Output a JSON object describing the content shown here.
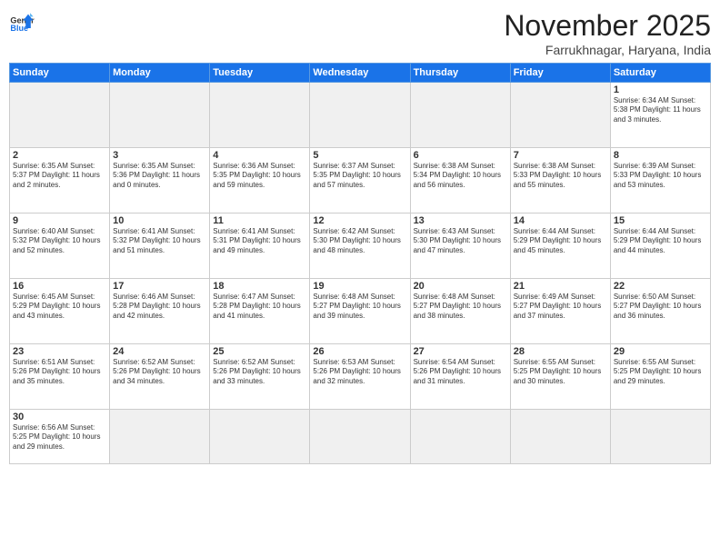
{
  "logo": {
    "text_general": "General",
    "text_blue": "Blue"
  },
  "header": {
    "month": "November 2025",
    "location": "Farrukhnagar, Haryana, India"
  },
  "weekdays": [
    "Sunday",
    "Monday",
    "Tuesday",
    "Wednesday",
    "Thursday",
    "Friday",
    "Saturday"
  ],
  "weeks": [
    [
      {
        "num": "",
        "info": "",
        "empty": true
      },
      {
        "num": "",
        "info": "",
        "empty": true
      },
      {
        "num": "",
        "info": "",
        "empty": true
      },
      {
        "num": "",
        "info": "",
        "empty": true
      },
      {
        "num": "",
        "info": "",
        "empty": true
      },
      {
        "num": "",
        "info": "",
        "empty": true
      },
      {
        "num": "1",
        "info": "Sunrise: 6:34 AM\nSunset: 5:38 PM\nDaylight: 11 hours and 3 minutes."
      }
    ],
    [
      {
        "num": "2",
        "info": "Sunrise: 6:35 AM\nSunset: 5:37 PM\nDaylight: 11 hours and 2 minutes."
      },
      {
        "num": "3",
        "info": "Sunrise: 6:35 AM\nSunset: 5:36 PM\nDaylight: 11 hours and 0 minutes."
      },
      {
        "num": "4",
        "info": "Sunrise: 6:36 AM\nSunset: 5:35 PM\nDaylight: 10 hours and 59 minutes."
      },
      {
        "num": "5",
        "info": "Sunrise: 6:37 AM\nSunset: 5:35 PM\nDaylight: 10 hours and 57 minutes."
      },
      {
        "num": "6",
        "info": "Sunrise: 6:38 AM\nSunset: 5:34 PM\nDaylight: 10 hours and 56 minutes."
      },
      {
        "num": "7",
        "info": "Sunrise: 6:38 AM\nSunset: 5:33 PM\nDaylight: 10 hours and 55 minutes."
      },
      {
        "num": "8",
        "info": "Sunrise: 6:39 AM\nSunset: 5:33 PM\nDaylight: 10 hours and 53 minutes."
      }
    ],
    [
      {
        "num": "9",
        "info": "Sunrise: 6:40 AM\nSunset: 5:32 PM\nDaylight: 10 hours and 52 minutes."
      },
      {
        "num": "10",
        "info": "Sunrise: 6:41 AM\nSunset: 5:32 PM\nDaylight: 10 hours and 51 minutes."
      },
      {
        "num": "11",
        "info": "Sunrise: 6:41 AM\nSunset: 5:31 PM\nDaylight: 10 hours and 49 minutes."
      },
      {
        "num": "12",
        "info": "Sunrise: 6:42 AM\nSunset: 5:30 PM\nDaylight: 10 hours and 48 minutes."
      },
      {
        "num": "13",
        "info": "Sunrise: 6:43 AM\nSunset: 5:30 PM\nDaylight: 10 hours and 47 minutes."
      },
      {
        "num": "14",
        "info": "Sunrise: 6:44 AM\nSunset: 5:29 PM\nDaylight: 10 hours and 45 minutes."
      },
      {
        "num": "15",
        "info": "Sunrise: 6:44 AM\nSunset: 5:29 PM\nDaylight: 10 hours and 44 minutes."
      }
    ],
    [
      {
        "num": "16",
        "info": "Sunrise: 6:45 AM\nSunset: 5:29 PM\nDaylight: 10 hours and 43 minutes."
      },
      {
        "num": "17",
        "info": "Sunrise: 6:46 AM\nSunset: 5:28 PM\nDaylight: 10 hours and 42 minutes."
      },
      {
        "num": "18",
        "info": "Sunrise: 6:47 AM\nSunset: 5:28 PM\nDaylight: 10 hours and 41 minutes."
      },
      {
        "num": "19",
        "info": "Sunrise: 6:48 AM\nSunset: 5:27 PM\nDaylight: 10 hours and 39 minutes."
      },
      {
        "num": "20",
        "info": "Sunrise: 6:48 AM\nSunset: 5:27 PM\nDaylight: 10 hours and 38 minutes."
      },
      {
        "num": "21",
        "info": "Sunrise: 6:49 AM\nSunset: 5:27 PM\nDaylight: 10 hours and 37 minutes."
      },
      {
        "num": "22",
        "info": "Sunrise: 6:50 AM\nSunset: 5:27 PM\nDaylight: 10 hours and 36 minutes."
      }
    ],
    [
      {
        "num": "23",
        "info": "Sunrise: 6:51 AM\nSunset: 5:26 PM\nDaylight: 10 hours and 35 minutes."
      },
      {
        "num": "24",
        "info": "Sunrise: 6:52 AM\nSunset: 5:26 PM\nDaylight: 10 hours and 34 minutes."
      },
      {
        "num": "25",
        "info": "Sunrise: 6:52 AM\nSunset: 5:26 PM\nDaylight: 10 hours and 33 minutes."
      },
      {
        "num": "26",
        "info": "Sunrise: 6:53 AM\nSunset: 5:26 PM\nDaylight: 10 hours and 32 minutes."
      },
      {
        "num": "27",
        "info": "Sunrise: 6:54 AM\nSunset: 5:26 PM\nDaylight: 10 hours and 31 minutes."
      },
      {
        "num": "28",
        "info": "Sunrise: 6:55 AM\nSunset: 5:25 PM\nDaylight: 10 hours and 30 minutes."
      },
      {
        "num": "29",
        "info": "Sunrise: 6:55 AM\nSunset: 5:25 PM\nDaylight: 10 hours and 29 minutes."
      }
    ],
    [
      {
        "num": "30",
        "info": "Sunrise: 6:56 AM\nSunset: 5:25 PM\nDaylight: 10 hours and 29 minutes."
      },
      {
        "num": "",
        "info": "",
        "empty": true
      },
      {
        "num": "",
        "info": "",
        "empty": true
      },
      {
        "num": "",
        "info": "",
        "empty": true
      },
      {
        "num": "",
        "info": "",
        "empty": true
      },
      {
        "num": "",
        "info": "",
        "empty": true
      },
      {
        "num": "",
        "info": "",
        "empty": true
      }
    ]
  ]
}
